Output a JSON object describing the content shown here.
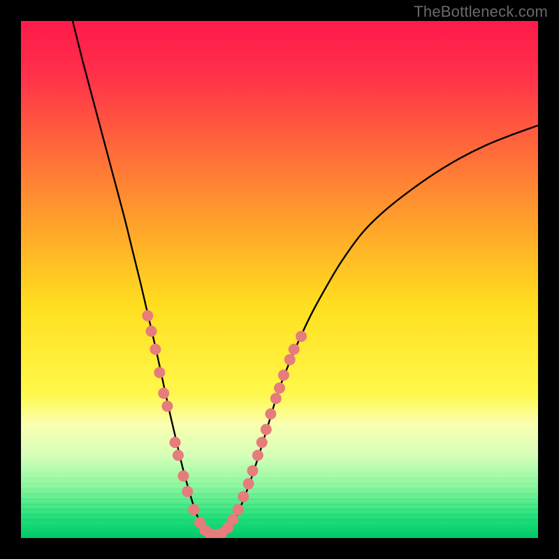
{
  "watermark": "TheBottleneck.com",
  "chart_data": {
    "type": "line",
    "title": "",
    "xlabel": "",
    "ylabel": "",
    "xlim": [
      0,
      100
    ],
    "ylim": [
      0,
      100
    ],
    "gradient_stops": [
      {
        "offset": 0.0,
        "color": "#ff1a4b"
      },
      {
        "offset": 0.1,
        "color": "#ff2f4a"
      },
      {
        "offset": 0.25,
        "color": "#ff6a3a"
      },
      {
        "offset": 0.4,
        "color": "#ffa52a"
      },
      {
        "offset": 0.55,
        "color": "#ffdf1f"
      },
      {
        "offset": 0.72,
        "color": "#fff84a"
      },
      {
        "offset": 0.78,
        "color": "#faffb0"
      },
      {
        "offset": 0.84,
        "color": "#d6ffb8"
      },
      {
        "offset": 0.9,
        "color": "#8cf7a0"
      },
      {
        "offset": 0.96,
        "color": "#22e07a"
      },
      {
        "offset": 1.0,
        "color": "#00c86a"
      }
    ],
    "series": [
      {
        "name": "bottleneck-curve",
        "x": [
          10.0,
          12.0,
          14.0,
          16.0,
          18.0,
          20.0,
          21.6,
          23.2,
          24.6,
          26.0,
          27.3,
          28.6,
          30.0,
          31.3,
          32.7,
          34.0,
          35.5,
          37.0,
          38.0,
          40.0,
          42.0,
          44.0,
          46.0,
          48.0,
          50.0,
          53.0,
          56.0,
          59.0,
          62.0,
          66.0,
          70.0,
          75.0,
          80.0,
          85.0,
          90.0,
          95.0,
          100.0
        ],
        "y": [
          100.0,
          92.0,
          84.5,
          77.0,
          69.5,
          62.0,
          55.5,
          49.0,
          43.0,
          37.0,
          31.0,
          25.0,
          19.0,
          13.5,
          8.5,
          4.5,
          1.8,
          0.6,
          0.6,
          1.8,
          5.0,
          10.0,
          16.0,
          22.5,
          29.0,
          36.5,
          43.0,
          48.5,
          53.5,
          59.0,
          63.0,
          67.0,
          70.5,
          73.5,
          76.0,
          78.0,
          79.8
        ]
      }
    ],
    "markers": {
      "name": "highlight-dots",
      "color": "#e77c7c",
      "radius": 8,
      "points": [
        {
          "x": 24.5,
          "y": 43.0
        },
        {
          "x": 25.2,
          "y": 40.0
        },
        {
          "x": 26.0,
          "y": 36.5
        },
        {
          "x": 26.8,
          "y": 32.0
        },
        {
          "x": 27.6,
          "y": 28.0
        },
        {
          "x": 28.3,
          "y": 25.5
        },
        {
          "x": 29.8,
          "y": 18.5
        },
        {
          "x": 30.4,
          "y": 16.0
        },
        {
          "x": 31.4,
          "y": 12.0
        },
        {
          "x": 32.2,
          "y": 9.0
        },
        {
          "x": 33.4,
          "y": 5.5
        },
        {
          "x": 34.6,
          "y": 3.0
        },
        {
          "x": 35.6,
          "y": 1.5
        },
        {
          "x": 36.6,
          "y": 0.8
        },
        {
          "x": 37.6,
          "y": 0.6
        },
        {
          "x": 38.8,
          "y": 0.9
        },
        {
          "x": 40.0,
          "y": 2.0
        },
        {
          "x": 41.0,
          "y": 3.6
        },
        {
          "x": 42.0,
          "y": 5.5
        },
        {
          "x": 43.0,
          "y": 8.0
        },
        {
          "x": 44.0,
          "y": 10.5
        },
        {
          "x": 44.8,
          "y": 13.0
        },
        {
          "x": 45.8,
          "y": 16.0
        },
        {
          "x": 46.6,
          "y": 18.5
        },
        {
          "x": 47.4,
          "y": 21.0
        },
        {
          "x": 48.3,
          "y": 24.0
        },
        {
          "x": 49.3,
          "y": 27.0
        },
        {
          "x": 50.0,
          "y": 29.0
        },
        {
          "x": 50.8,
          "y": 31.5
        },
        {
          "x": 52.0,
          "y": 34.5
        },
        {
          "x": 52.8,
          "y": 36.5
        },
        {
          "x": 54.2,
          "y": 39.0
        }
      ]
    }
  }
}
